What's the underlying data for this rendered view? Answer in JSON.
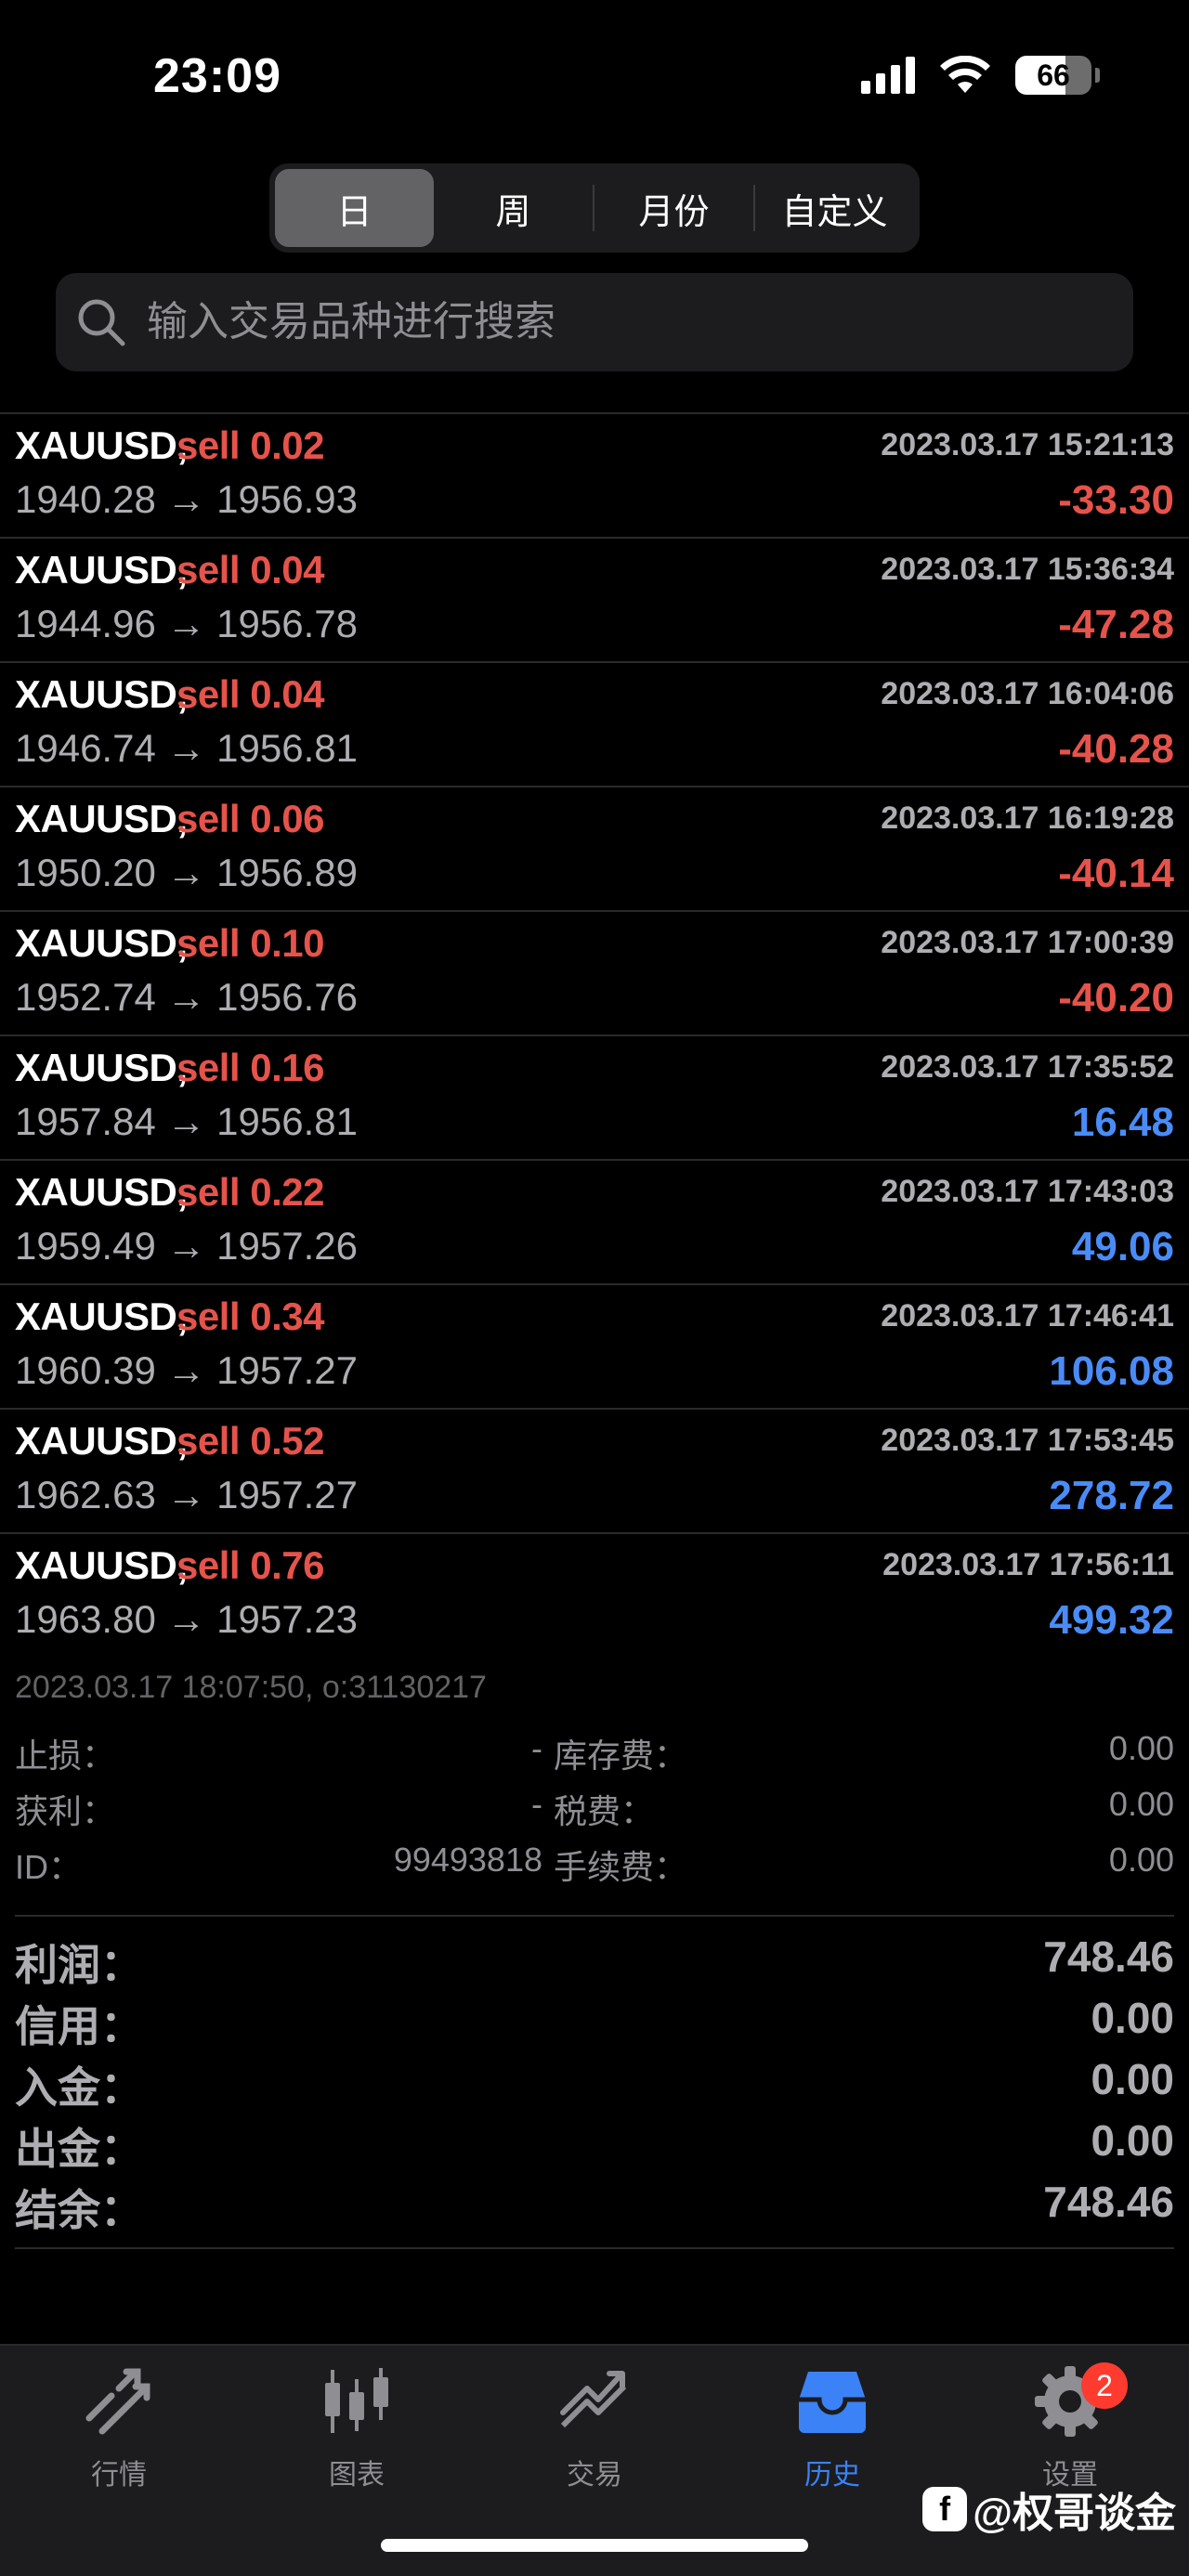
{
  "status_bar": {
    "time": "23:09",
    "battery_level": "66"
  },
  "segmented": {
    "items": [
      "日",
      "周",
      "月份",
      "自定义"
    ],
    "active_index": 0
  },
  "search": {
    "placeholder": "输入交易品种进行搜索"
  },
  "trades": [
    {
      "symbol": "XAUUSD,",
      "side": "sell 0.02",
      "time": "2023.03.17 15:21:13",
      "prices": "1940.28 → 1956.93",
      "profit": "-33.30",
      "sign": "neg"
    },
    {
      "symbol": "XAUUSD,",
      "side": "sell 0.04",
      "time": "2023.03.17 15:36:34",
      "prices": "1944.96 → 1956.78",
      "profit": "-47.28",
      "sign": "neg"
    },
    {
      "symbol": "XAUUSD,",
      "side": "sell 0.04",
      "time": "2023.03.17 16:04:06",
      "prices": "1946.74 → 1956.81",
      "profit": "-40.28",
      "sign": "neg"
    },
    {
      "symbol": "XAUUSD,",
      "side": "sell 0.06",
      "time": "2023.03.17 16:19:28",
      "prices": "1950.20 → 1956.89",
      "profit": "-40.14",
      "sign": "neg"
    },
    {
      "symbol": "XAUUSD,",
      "side": "sell 0.10",
      "time": "2023.03.17 17:00:39",
      "prices": "1952.74 → 1956.76",
      "profit": "-40.20",
      "sign": "neg"
    },
    {
      "symbol": "XAUUSD,",
      "side": "sell 0.16",
      "time": "2023.03.17 17:35:52",
      "prices": "1957.84 → 1956.81",
      "profit": "16.48",
      "sign": "pos"
    },
    {
      "symbol": "XAUUSD,",
      "side": "sell 0.22",
      "time": "2023.03.17 17:43:03",
      "prices": "1959.49 → 1957.26",
      "profit": "49.06",
      "sign": "pos"
    },
    {
      "symbol": "XAUUSD,",
      "side": "sell 0.34",
      "time": "2023.03.17 17:46:41",
      "prices": "1960.39 → 1957.27",
      "profit": "106.08",
      "sign": "pos"
    },
    {
      "symbol": "XAUUSD,",
      "side": "sell 0.52",
      "time": "2023.03.17 17:53:45",
      "prices": "1962.63 → 1957.27",
      "profit": "278.72",
      "sign": "pos"
    },
    {
      "symbol": "XAUUSD,",
      "side": "sell 0.76",
      "time": "2023.03.17 17:56:11",
      "prices": "1963.80 → 1957.23",
      "profit": "499.32",
      "sign": "pos"
    }
  ],
  "details": {
    "meta": "2023.03.17 18:07:50, o:31130217",
    "rows": [
      {
        "label1": "止损：",
        "value1": "-",
        "label2": "库存费：",
        "value2": "0.00"
      },
      {
        "label1": "获利：",
        "value1": "-",
        "label2": "税费：",
        "value2": "0.00"
      },
      {
        "label1": "ID：",
        "value1": "99493818",
        "label2": "手续费：",
        "value2": "0.00"
      }
    ]
  },
  "summary": [
    {
      "key": "利润：",
      "value": "748.46"
    },
    {
      "key": "信用：",
      "value": "0.00"
    },
    {
      "key": "入金：",
      "value": "0.00"
    },
    {
      "key": "出金：",
      "value": "0.00"
    },
    {
      "key": "结余：",
      "value": "748.46"
    }
  ],
  "tab_bar": {
    "tabs": [
      {
        "label": "行情",
        "icon": "quotes-icon"
      },
      {
        "label": "图表",
        "icon": "chart-icon"
      },
      {
        "label": "交易",
        "icon": "trade-icon"
      },
      {
        "label": "历史",
        "icon": "history-icon"
      },
      {
        "label": "设置",
        "icon": "settings-icon"
      }
    ],
    "active_index": 3,
    "settings_badge": "2"
  },
  "watermark": {
    "text": "@权哥谈金"
  },
  "colors": {
    "loss": "#e5534b",
    "gain": "#4a8cf7",
    "active_tab": "#3b82f6"
  }
}
